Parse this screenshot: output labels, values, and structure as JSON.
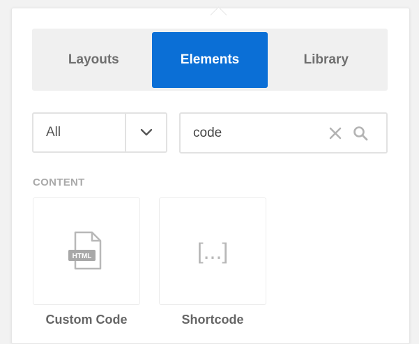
{
  "tabs": [
    {
      "label": "Layouts",
      "active": false
    },
    {
      "label": "Elements",
      "active": true
    },
    {
      "label": "Library",
      "active": false
    }
  ],
  "filter": {
    "selected": "All"
  },
  "search": {
    "value": "code",
    "placeholder": ""
  },
  "section": {
    "title": "CONTENT"
  },
  "elements": [
    {
      "label": "Custom Code",
      "icon": "html-file-icon",
      "icon_badge": "HTML"
    },
    {
      "label": "Shortcode",
      "icon": "shortcode-icon",
      "icon_text": "[...]"
    }
  ],
  "colors": {
    "accent": "#0b6fd6",
    "tab_bg": "#f0f0f0",
    "muted": "#a9a9a9"
  }
}
